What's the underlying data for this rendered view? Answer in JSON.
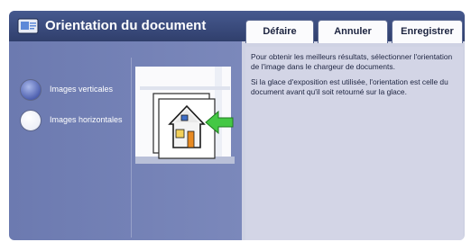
{
  "header": {
    "title": "Orientation du document",
    "buttons": {
      "undo": "Défaire",
      "cancel": "Annuler",
      "save": "Enregistrer"
    }
  },
  "options": {
    "portrait": {
      "label": "Images verticales",
      "selected": true
    },
    "landscape": {
      "label": "Images horizontales",
      "selected": false
    }
  },
  "help": {
    "paragraph1": "Pour obtenir les meilleurs résultats, sélectionner l'orientation de l'image dans le chargeur de documents.",
    "paragraph2": "Si la glace d'exposition est utilisée, l'orientation est celle du document avant qu'il soit retourné sur la glace."
  },
  "colors": {
    "header": "#3a4a7d",
    "left_pane": "#7481b7",
    "info_pane": "#d3d5e6",
    "arrow": "#3cc33c"
  },
  "icons": [
    "scanner-icon",
    "house-icon",
    "arrow-left-icon"
  ]
}
